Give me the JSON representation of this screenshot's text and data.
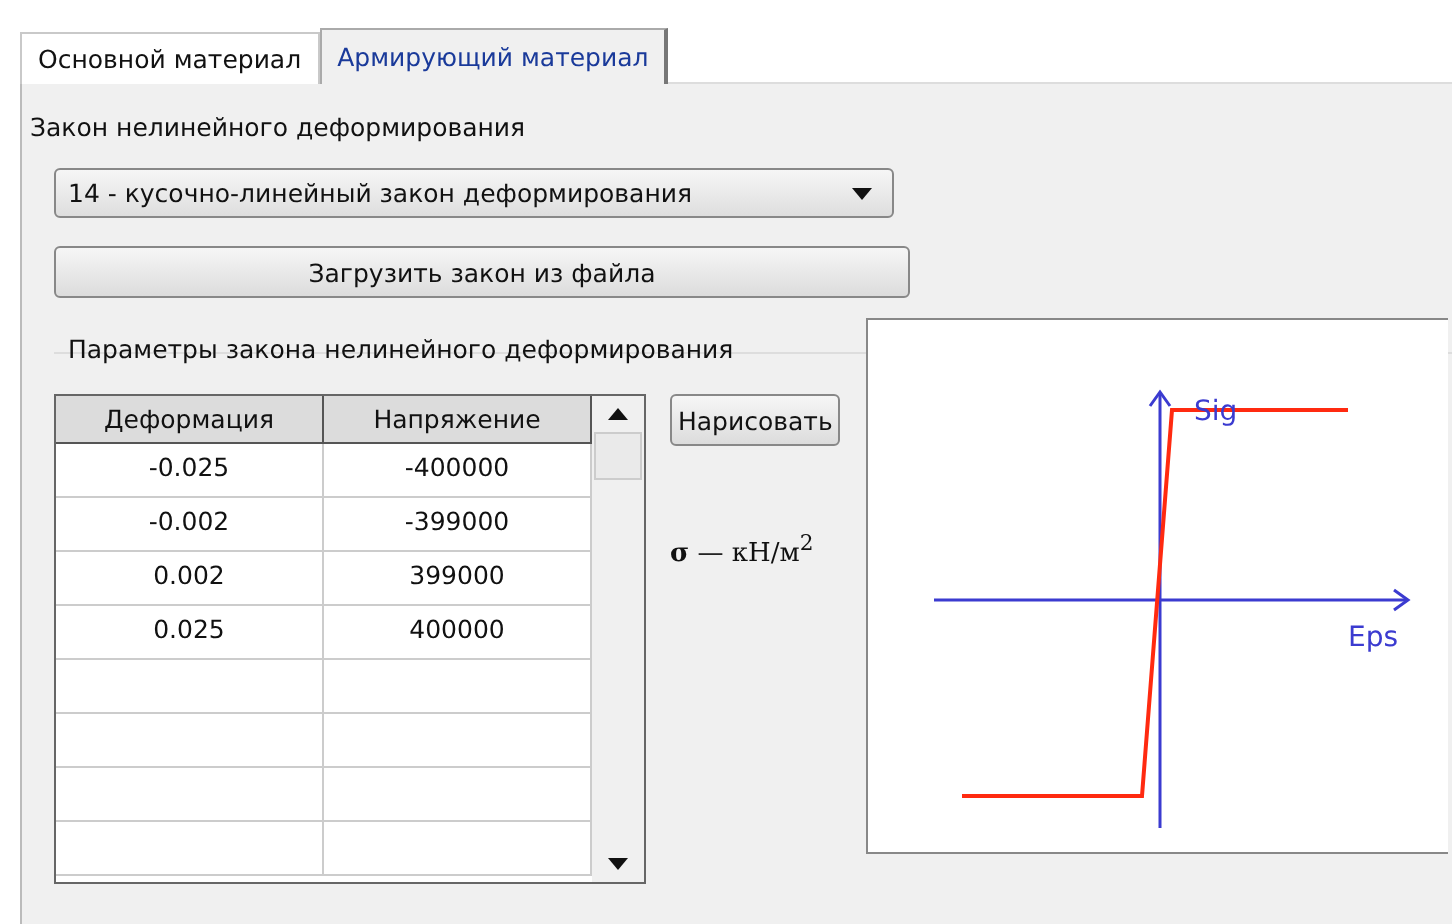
{
  "tabs": [
    {
      "label": "Основной материал",
      "selected": false
    },
    {
      "label": "Армирующий материал",
      "selected": true
    }
  ],
  "law_label": "Закон нелинейного деформирования",
  "law_select": {
    "value": "14 - кусочно-линейный закон деформирования"
  },
  "load_button": "Загрузить закон из файла",
  "params_group": {
    "title": "Параметры закона нелинейного деформирования",
    "table": {
      "columns": [
        "Деформация",
        "Напряжение"
      ],
      "rows": [
        [
          "-0.025",
          "-400000"
        ],
        [
          "-0.002",
          "-399000"
        ],
        [
          "0.002",
          "399000"
        ],
        [
          "0.025",
          "400000"
        ]
      ]
    },
    "draw_button": "Нарисовать",
    "units": "**σ** — кН/м$^{2}$",
    "plot": {
      "y_axis_label": "Sig",
      "x_axis_label": "Eps"
    }
  }
}
